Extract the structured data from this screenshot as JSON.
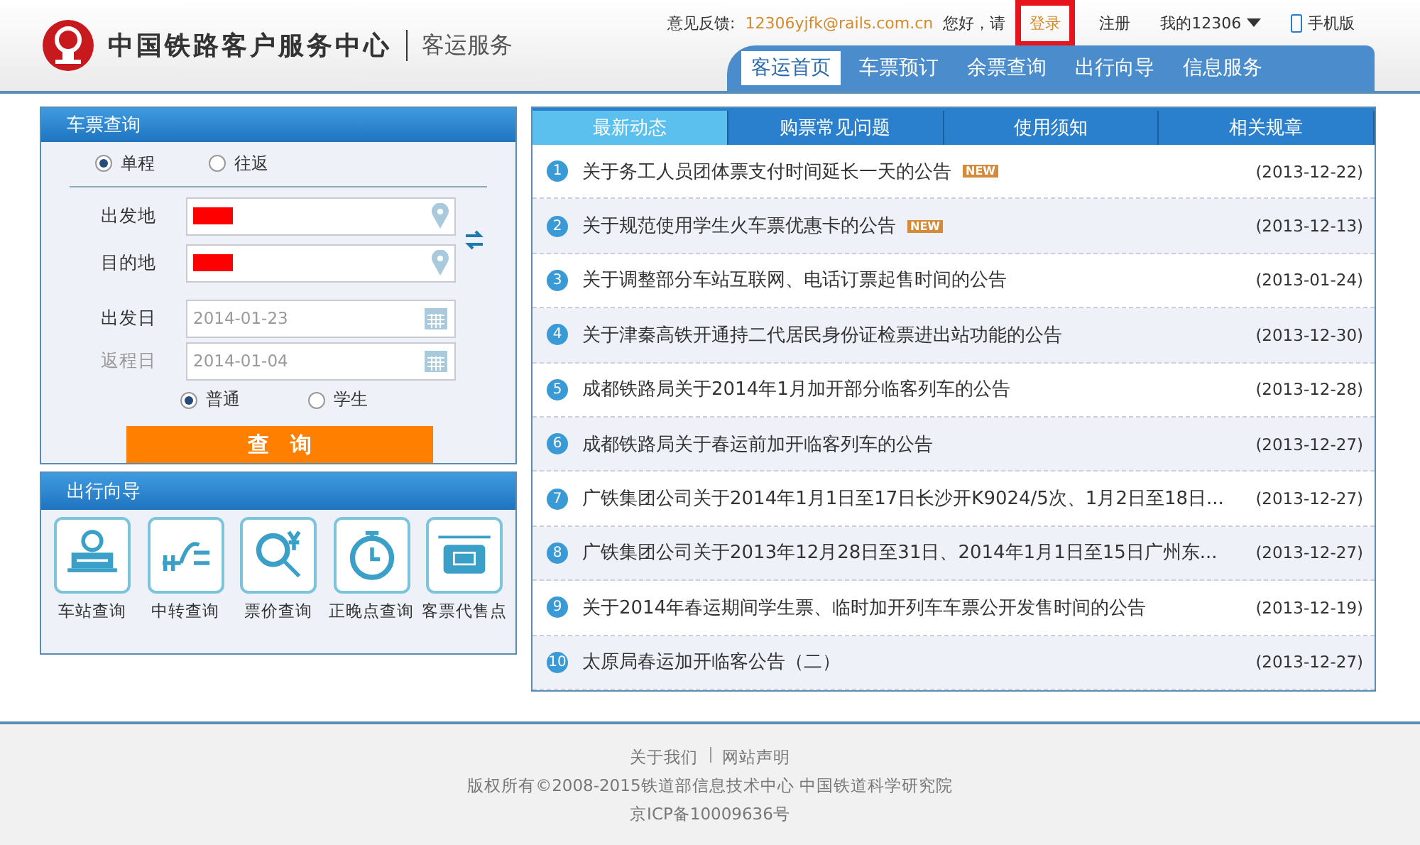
{
  "header": {
    "title": "中国铁路客户服务中心",
    "subtitle": "客运服务",
    "feedback_label": "意见反馈:",
    "feedback_email": "12306yjfk@rails.com.cn",
    "greeting": "您好，请",
    "login": "登录",
    "register": "注册",
    "my_account": "我的12306",
    "mobile": "手机版"
  },
  "nav": [
    {
      "label": "客运首页",
      "selected": true
    },
    {
      "label": "车票预订",
      "selected": false
    },
    {
      "label": "余票查询",
      "selected": false
    },
    {
      "label": "出行向导",
      "selected": false
    },
    {
      "label": "信息服务",
      "selected": false
    }
  ],
  "ticket_query": {
    "title": "车票查询",
    "trip_types": [
      {
        "label": "单程",
        "selected": true
      },
      {
        "label": "往返",
        "selected": false
      }
    ],
    "stations": [
      {
        "label": "出发地"
      },
      {
        "label": "目的地"
      }
    ],
    "dates": [
      {
        "label": "出发日",
        "value": "2014-01-23",
        "disabled": false
      },
      {
        "label": "返程日",
        "value": "2014-01-04",
        "disabled": true
      }
    ],
    "passenger_types": [
      {
        "label": "普通",
        "selected": true
      },
      {
        "label": "学生",
        "selected": false
      }
    ],
    "search_button": "查　询"
  },
  "travel_guide": {
    "title": "出行向导",
    "items": [
      {
        "label": "车站查询",
        "kind": "station"
      },
      {
        "label": "中转查询",
        "kind": "transfer"
      },
      {
        "label": "票价查询",
        "kind": "price"
      },
      {
        "label": "正晚点查询",
        "kind": "clock"
      },
      {
        "label": "客票代售点",
        "kind": "agency"
      }
    ]
  },
  "news": {
    "tabs": [
      {
        "label": "最新动态",
        "selected": true
      },
      {
        "label": "购票常见问题",
        "selected": false
      },
      {
        "label": "使用须知",
        "selected": false
      },
      {
        "label": "相关规章",
        "selected": false
      }
    ],
    "items": [
      {
        "number": "1",
        "title": "关于务工人员团体票支付时间延长一天的公告",
        "badge": "NEW",
        "date": "(2013-12-22)"
      },
      {
        "number": "2",
        "title": "关于规范使用学生火车票优惠卡的公告",
        "badge": "NEW",
        "date": "(2013-12-13)"
      },
      {
        "number": "3",
        "title": "关于调整部分车站互联网、电话订票起售时间的公告",
        "date": "(2013-01-24)"
      },
      {
        "number": "4",
        "title": "关于津秦高铁开通持二代居民身份证检票进出站功能的公告",
        "date": "(2013-12-30)"
      },
      {
        "number": "5",
        "title": "成都铁路局关于2014年1月加开部分临客列车的公告",
        "date": "(2013-12-28)"
      },
      {
        "number": "6",
        "title": "成都铁路局关于春运前加开临客列车的公告",
        "date": "(2013-12-27)"
      },
      {
        "number": "7",
        "title": "广铁集团公司关于2014年1月1日至17日长沙开K9024/5次、1月2日至18日...",
        "date": "(2013-12-27)"
      },
      {
        "number": "8",
        "title": "广铁集团公司关于2013年12月28日至31日、2014年1月1日至15日广州东...",
        "date": "(2013-12-27)"
      },
      {
        "number": "9",
        "title": "关于2014年春运期间学生票、临时加开列车车票公开发售时间的公告",
        "date": "(2013-12-19)"
      },
      {
        "number": "10",
        "title": "太原局春运加开临客公告（二）",
        "date": "(2013-12-27)"
      }
    ]
  },
  "footer": {
    "links": [
      "关于我们",
      "网站声明"
    ],
    "copyright": "版权所有©2008-2015铁道部信息技术中心  中国铁道科学研究院",
    "icp": "京ICP备10009636号"
  }
}
